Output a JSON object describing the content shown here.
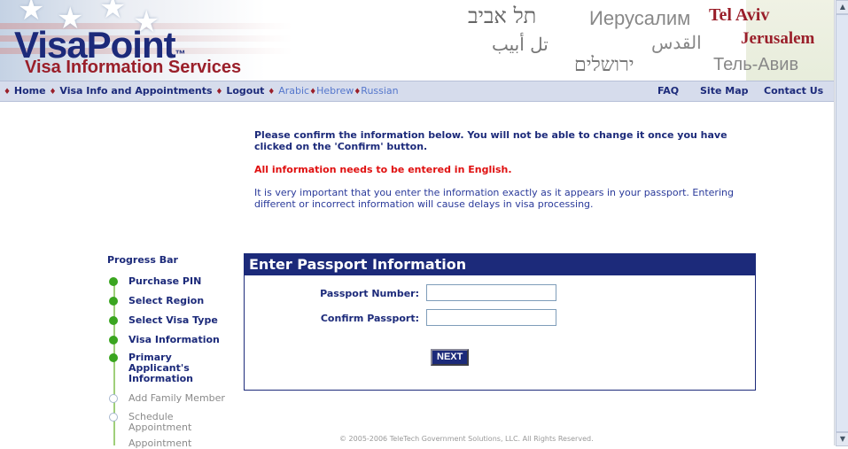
{
  "header": {
    "logo_main": "VisaPoint",
    "logo_tm": "™",
    "tagline": "Visa Information Services",
    "cities": {
      "hebrew_tel_aviv": "תל אביב",
      "russian_jerusalem": "Иерусалим",
      "english_tel_aviv": "Tel Aviv",
      "arabic_tel_aviv": "تل أبيب",
      "arabic_jerusalem": "القدس",
      "english_jerusalem": "Jerusalem",
      "hebrew_jerusalem": "ירושלים",
      "russian_tel_aviv": "Тель-Авив"
    }
  },
  "nav": {
    "bullet": "♦",
    "home": "Home",
    "visa_info": "Visa Info and Appointments",
    "logout": "Logout",
    "arabic": "Arabic",
    "hebrew": "Hebrew",
    "russian": "Russian",
    "faq": "FAQ",
    "site_map": "Site Map",
    "contact": "Contact Us"
  },
  "instructions": {
    "confirm": "Please confirm the information below.  You will not be able to change it once you have clicked on the 'Confirm' button.",
    "english": "All information needs to be entered in English.",
    "important": "It is very important that you enter the information exactly as it appears in your passport. Entering different or incorrect information will cause delays in visa processing."
  },
  "progress": {
    "title": "Progress Bar",
    "steps": [
      {
        "label": "Purchase PIN",
        "done": true
      },
      {
        "label": "Select Region",
        "done": true
      },
      {
        "label": "Select Visa Type",
        "done": true
      },
      {
        "label": "Visa Information",
        "done": true
      },
      {
        "label": "Primary\nApplicant's\nInformation",
        "done": true
      },
      {
        "label": "Add Family Member",
        "done": false
      },
      {
        "label": "Schedule\nAppointment",
        "done": false
      },
      {
        "label": "Appointment",
        "done": false
      }
    ]
  },
  "form": {
    "title": "Enter Passport Information",
    "passport_label": "Passport Number:",
    "passport_value": "",
    "confirm_label": "Confirm Passport:",
    "confirm_value": "",
    "next_label": "NEXT"
  },
  "footer": {
    "copyright": "© 2005-2006 TeleTech Government Solutions, LLC. All Rights Reserved."
  },
  "colors": {
    "brand_navy": "#1c2a7a",
    "brand_red": "#9a1f2a",
    "warning_red": "#e01010",
    "progress_green": "#3aa51f"
  }
}
